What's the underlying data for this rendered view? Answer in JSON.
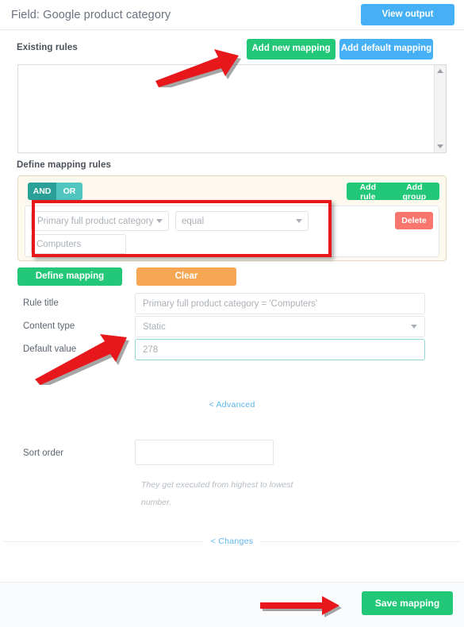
{
  "header": {
    "title": "Field: Google product category",
    "view_output_label": "View output"
  },
  "existing_rules": {
    "label": "Existing rules",
    "add_new_mapping_label": "Add new mapping",
    "add_default_mapping_label": "Add default mapping",
    "textarea_value": ""
  },
  "define_mapping_rules": {
    "label": "Define mapping rules",
    "toggle": {
      "and_label": "AND",
      "or_label": "OR",
      "active": "AND"
    },
    "add_rule_label": "Add rule",
    "add_group_label": "Add group",
    "rule": {
      "field_value": "Primary full product category",
      "operator_value": "equal",
      "value_input": "Computers",
      "delete_label": "Delete"
    }
  },
  "actions": {
    "define_mapping_label": "Define mapping",
    "clear_label": "Clear"
  },
  "form": {
    "rule_title": {
      "label": "Rule title",
      "value": "Primary full product category = 'Computers'"
    },
    "content_type": {
      "label": "Content type",
      "value": "Static"
    },
    "default_value": {
      "label": "Default value",
      "value": "278"
    },
    "advanced_link": "< Advanced",
    "sort_order": {
      "label": "Sort order",
      "value": "",
      "help": "They get executed from highest to lowest number."
    },
    "changes_link": "< Changes"
  },
  "footer": {
    "save_mapping_label": "Save mapping"
  },
  "colors": {
    "green": "#22c878",
    "blue": "#45b0f5",
    "orange": "#f7a654",
    "red": "#f8766d",
    "teal_active": "#2aa198",
    "teal": "#4fc7c0",
    "annotation_red": "#e8171b",
    "link_blue": "#5bb5ef"
  }
}
